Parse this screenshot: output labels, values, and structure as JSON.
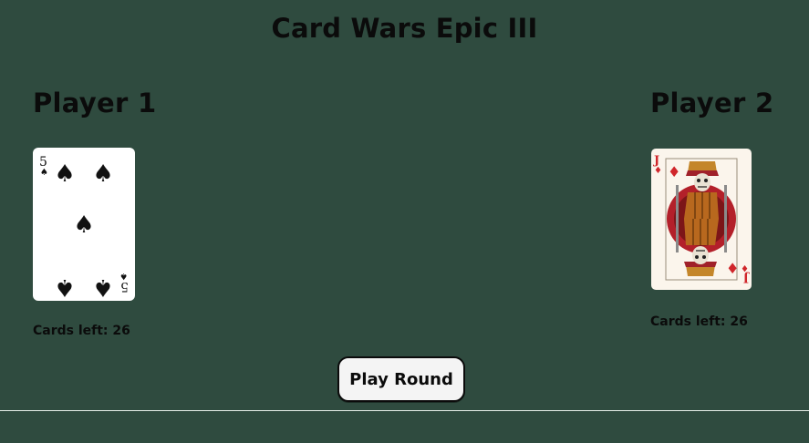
{
  "game": {
    "title": "Card Wars Epic III"
  },
  "players": [
    {
      "name": "Player 1",
      "cards_left_label": "Cards left: 26",
      "card": {
        "rank": "5",
        "suit": "spades",
        "suit_symbol": "♠",
        "color": "#111111"
      }
    },
    {
      "name": "Player 2",
      "cards_left_label": "Cards left: 26",
      "card": {
        "rank": "J",
        "suit": "diamonds",
        "suit_symbol": "♦",
        "color": "#d0262b"
      }
    }
  ],
  "controls": {
    "play_label": "Play Round"
  },
  "colors": {
    "background": "#2f4b3f",
    "button_bg": "#f4f4f4",
    "text": "#0b0b0b"
  }
}
